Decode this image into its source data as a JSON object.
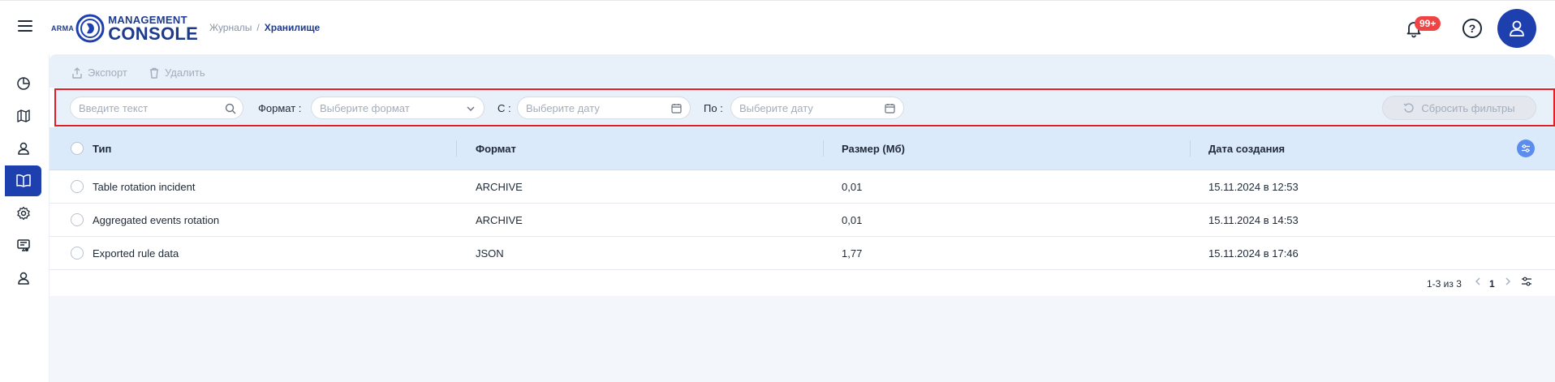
{
  "header": {
    "logo": {
      "prefix": "ARMA",
      "line1": "MANAGEMENT",
      "line2": "CONSOLE"
    },
    "breadcrumb": {
      "parent": "Журналы",
      "separator": "/",
      "current": "Хранилище"
    },
    "notifications_badge": "99+",
    "help_symbol": "?"
  },
  "sidebar": {
    "items": [
      {
        "icon": "dashboard-icon",
        "active": false
      },
      {
        "icon": "map-icon",
        "active": false
      },
      {
        "icon": "user-icon",
        "active": false
      },
      {
        "icon": "book-icon",
        "active": true
      },
      {
        "icon": "gear-icon",
        "active": false
      },
      {
        "icon": "monitor-icon",
        "active": false
      },
      {
        "icon": "profile-icon",
        "active": false
      }
    ]
  },
  "toolbar": {
    "export_label": "Экспорт",
    "delete_label": "Удалить"
  },
  "filters": {
    "search_placeholder": "Введите текст",
    "format_label": "Формат",
    "format_placeholder": "Выберите формат",
    "from_label": "С",
    "from_placeholder": "Выберите дату",
    "to_label": "По",
    "to_placeholder": "Выберите дату",
    "reset_label": "Сбросить фильтры"
  },
  "table": {
    "columns": [
      "Тип",
      "Формат",
      "Размер (Мб)",
      "Дата создания"
    ],
    "rows": [
      [
        "Table rotation incident",
        "ARCHIVE",
        "0,01",
        "15.11.2024 в 12:53"
      ],
      [
        "Aggregated events rotation",
        "ARCHIVE",
        "0,01",
        "15.11.2024 в 14:53"
      ],
      [
        "Exported rule data",
        "JSON",
        "1,77",
        "15.11.2024 в 17:46"
      ]
    ]
  },
  "pagination": {
    "range": "1-3 из 3",
    "page": "1"
  },
  "colors": {
    "accent": "#1e40af",
    "highlight_border": "#e11d2a",
    "badge": "#ef4444"
  }
}
